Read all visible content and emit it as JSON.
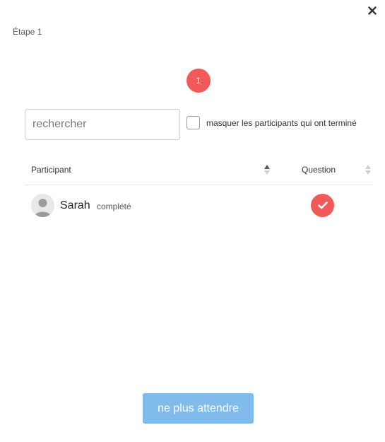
{
  "header": {
    "close_icon": "close-icon",
    "step_title": "Étape 1"
  },
  "step_badge": {
    "number": "1",
    "color": "#f25a5a"
  },
  "filters": {
    "search_placeholder": "rechercher",
    "search_value": "",
    "hide_finished_label": "masquer les participants qui ont terminé",
    "hide_finished_checked": false
  },
  "table": {
    "columns": [
      {
        "label": "Participant",
        "sort_icon": "sort-icon",
        "sorted": "asc"
      },
      {
        "label": "Question",
        "sort_icon": "sort-icon",
        "sorted": "none"
      }
    ],
    "rows": [
      {
        "avatar_icon": "user-avatar-icon",
        "name": "Sarah",
        "status": "complété",
        "question_state_icon": "check-icon"
      }
    ]
  },
  "footer": {
    "stop_waiting_label": "ne plus attendre",
    "button_color": "#80bbec"
  }
}
